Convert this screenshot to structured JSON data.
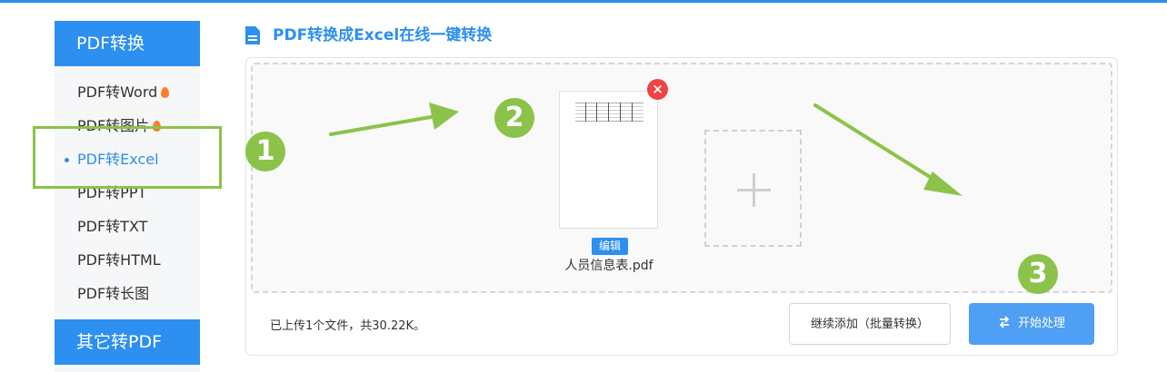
{
  "sidebar": {
    "section1_title": "PDF转换",
    "items": [
      {
        "label": "PDF转Word",
        "hot": true
      },
      {
        "label": "PDF转图片",
        "hot": true
      },
      {
        "label": "PDF转Excel",
        "active": true
      },
      {
        "label": "PDF转PPT"
      },
      {
        "label": "PDF转TXT"
      },
      {
        "label": "PDF转HTML"
      },
      {
        "label": "PDF转长图"
      }
    ],
    "section2_title": "其它转PDF"
  },
  "main": {
    "title": "PDF转换成Excel在线一键转换",
    "file": {
      "name": "人员信息表.pdf",
      "edit_label": "编辑",
      "remove_symbol": "×"
    },
    "status_text": "已上传1个文件，共30.22K。",
    "continue_button": "继续添加（批量转换）",
    "start_button": "开始处理"
  },
  "annotations": {
    "step1": "1",
    "step2": "2",
    "step3": "3"
  },
  "colors": {
    "accent": "#2d8ff0",
    "annotation_green": "#8bc34a",
    "remove_red": "#f04343"
  },
  "icons": {
    "title_icon": "document-icon",
    "start_icon": "swap-arrows-icon",
    "add_icon": "plus-icon",
    "hot_icon": "flame-icon"
  }
}
